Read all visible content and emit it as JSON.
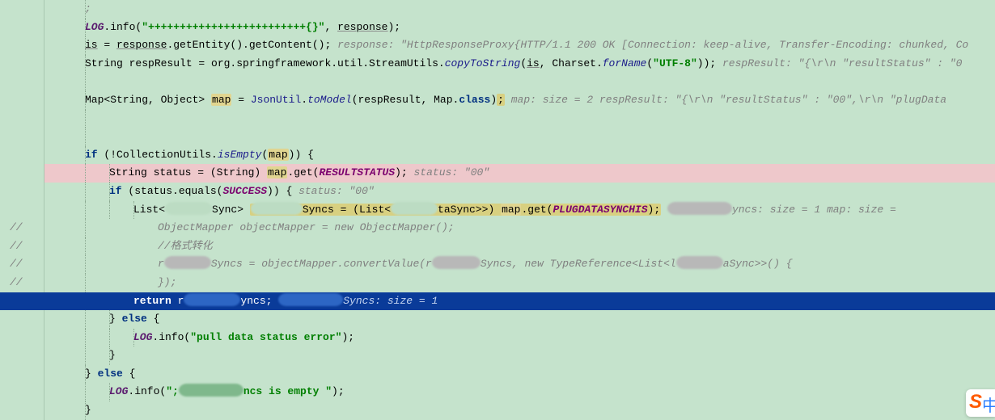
{
  "lines": {
    "l0": {
      "comment": ";"
    },
    "l1": {
      "log": "LOG",
      "method": ".info(",
      "str": "\"+++++++++++++++++++++++++{}\"",
      "arg": "response",
      "close": ");"
    },
    "l2": {
      "lhs": "is",
      "assign": " = ",
      "rhs1": "response",
      "rhs2": ".getEntity().getContent();",
      "eval": "  response: \"HttpResponseProxy{HTTP/1.1 200 OK [Connection: keep-alive, Transfer-Encoding: chunked, Co"
    },
    "l3": {
      "type": "String respResult = org.springframework.util.StreamUtils.",
      "static": "copyToString",
      "open": "(",
      "arg1": "is",
      "mid": ", Charset.",
      "static2": "forName",
      "open2": "(",
      "str": "\"UTF-8\"",
      "close": "));",
      "eval": "  respResult: \"{\\r\\n  \"resultStatus\" : \"0"
    },
    "l5": {
      "pre": "Map<String, Object> ",
      "map": "map",
      "assign": " = ",
      "cls": "JsonUtil",
      "dot": ".",
      "static": "toModel",
      "args_open": "(respResult, Map.",
      "kw_class": "class",
      "args_close": ")",
      "semi": ";",
      "eval": "  map:  size = 2  respResult: \"{\\r\\n  \"resultStatus\" : \"00\",\\r\\n  \"plugData"
    },
    "l8": {
      "kw": "if",
      "cond_open": " (!CollectionUtils.",
      "static": "isEmpty",
      "cond_mid": "(",
      "map": "map",
      "cond_close": ")) {"
    },
    "l9": {
      "pre": "String status = (String) ",
      "map": "map",
      "get": ".get(",
      "const": "RESULTSTATUS",
      "close": ");",
      "eval": "  status: \"00\""
    },
    "l10": {
      "kw": "if",
      "open": " (status.equals(",
      "const": "SUCCESS",
      "close": ")) {",
      "eval": "  status: \"00\""
    },
    "l11": {
      "pre": "List<",
      "mid1": "Sync> ",
      "mid2": "Syncs = (List<",
      "mid3": "taSync>>) ",
      "map": "map",
      "get": ".get(",
      "const": "PLUGDATASYNCHIS",
      "close": ");",
      "eval_tail": "yncs:  size = 1  map:  size ="
    },
    "l12": {
      "comment": "ObjectMapper objectMapper = new ObjectMapper();"
    },
    "l13": {
      "comment": "//格式转化"
    },
    "l14": {
      "comment_pre": "r",
      "comment_mid": "Syncs = objectMapper.convertValue(r",
      "comment_mid2": "Syncs, new TypeReference<List<l",
      "comment_mid3": "aSync>>() {"
    },
    "l15": {
      "comment": "});"
    },
    "l16": {
      "kw": "return",
      "mid": " r",
      "tail": "yncs;",
      "eval": "Syncs:  size = 1"
    },
    "l17": {
      "close": "} ",
      "kw": "else",
      "open": " {"
    },
    "l18": {
      "log": "LOG",
      "method": ".info(",
      "str": "\"pull data status error\"",
      "close": ");"
    },
    "l19": {
      "close": "}"
    },
    "l20": {
      "close": "} ",
      "kw": "else",
      "open": " {"
    },
    "l21": {
      "log": "LOG",
      "method": ".info(",
      "str_open": "\";",
      "str_close": "ncs is empty \"",
      "close": ");"
    },
    "l22": {
      "close": "}"
    }
  },
  "gutter": {
    "slash": "//"
  }
}
